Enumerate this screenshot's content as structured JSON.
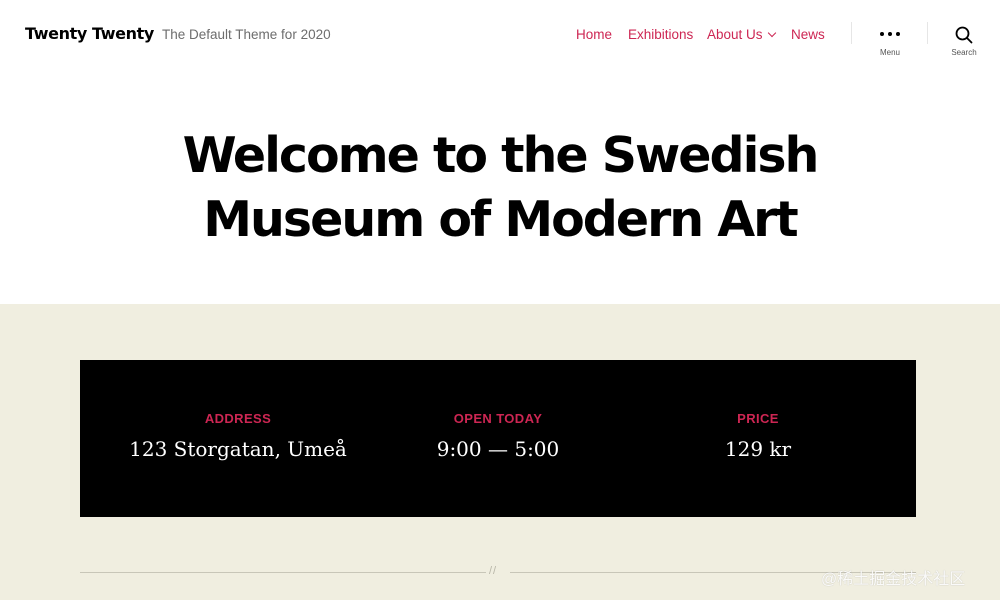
{
  "header": {
    "site_title": "Twenty Twenty",
    "site_description": "The Default Theme for 2020"
  },
  "nav": {
    "items": [
      {
        "label": "Home"
      },
      {
        "label": "Exhibitions"
      },
      {
        "label": "About Us",
        "has_submenu": true
      },
      {
        "label": "News"
      }
    ],
    "menu_toggle_label": "Menu",
    "search_toggle_label": "Search"
  },
  "hero": {
    "title_line1": "Welcome to the Swedish",
    "title_line2": "Museum of Modern Art"
  },
  "info": {
    "address_label": "ADDRESS",
    "address_value": "123 Storgatan, Umeå",
    "open_label": "OPEN TODAY",
    "open_value": "9:00 — 5:00",
    "price_label": "PRICE",
    "price_value": "129 kr"
  },
  "divider_mark": "//",
  "watermark": "@稀土掘金技术社区",
  "colors": {
    "accent": "#cd2653",
    "background_light": "#f0eee0",
    "info_box": "#000000",
    "text": "#000000"
  },
  "icons": {
    "menu": "ellipsis-icon",
    "search": "search-icon",
    "submenu": "chevron-down-icon"
  }
}
